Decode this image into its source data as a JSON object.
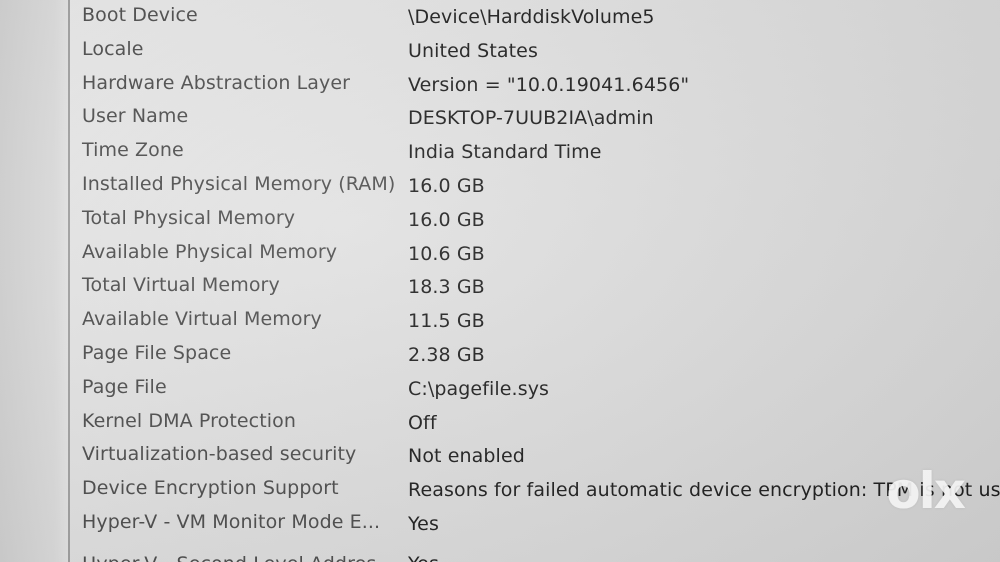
{
  "system_summary": {
    "rows": [
      {
        "item": "Boot Device",
        "value": "\\Device\\HarddiskVolume5"
      },
      {
        "item": "Locale",
        "value": "United States"
      },
      {
        "item": "Hardware Abstraction Layer",
        "value": "Version = \"10.0.19041.6456\""
      },
      {
        "item": "User Name",
        "value": "DESKTOP-7UUB2IA\\admin"
      },
      {
        "item": "Time Zone",
        "value": "India Standard Time"
      },
      {
        "item": "Installed Physical Memory (RAM)",
        "value": "16.0 GB"
      },
      {
        "item": "Total Physical Memory",
        "value": "16.0 GB"
      },
      {
        "item": "Available Physical Memory",
        "value": "10.6 GB"
      },
      {
        "item": "Total Virtual Memory",
        "value": "18.3 GB"
      },
      {
        "item": "Available Virtual Memory",
        "value": "11.5 GB"
      },
      {
        "item": "Page File Space",
        "value": "2.38 GB"
      },
      {
        "item": "Page File",
        "value": "C:\\pagefile.sys"
      },
      {
        "item": "Kernel DMA Protection",
        "value": "Off"
      },
      {
        "item": "Virtualization-based security",
        "value": "Not enabled"
      },
      {
        "item": "Device Encryption Support",
        "value": "Reasons for failed automatic device encryption: TPM is not usable"
      },
      {
        "item": "Hyper-V - VM Monitor Mode E...",
        "value": "Yes"
      },
      {
        "item": "Hyper-V - Second Level Addres...",
        "value": "Yes"
      }
    ]
  },
  "watermark": {
    "text": "olx"
  }
}
